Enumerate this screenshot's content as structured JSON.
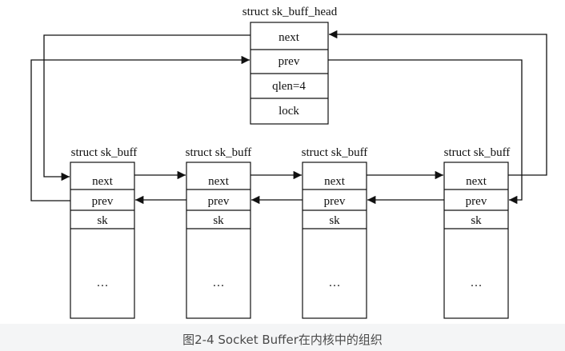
{
  "head": {
    "title": "struct sk_buff_head",
    "fields": [
      "next",
      "prev",
      "qlen=4",
      "lock"
    ]
  },
  "buffers": [
    {
      "title": "struct sk_buff",
      "fields": [
        "next",
        "prev",
        "sk"
      ],
      "ellipsis": "…"
    },
    {
      "title": "struct sk_buff",
      "fields": [
        "next",
        "prev",
        "sk"
      ],
      "ellipsis": "…"
    },
    {
      "title": "struct sk_buff",
      "fields": [
        "next",
        "prev",
        "sk"
      ],
      "ellipsis": "…"
    },
    {
      "title": "struct sk_buff",
      "fields": [
        "next",
        "prev",
        "sk"
      ],
      "ellipsis": "…"
    }
  ],
  "caption": "图2-4 Socket Buffer在内核中的组织"
}
